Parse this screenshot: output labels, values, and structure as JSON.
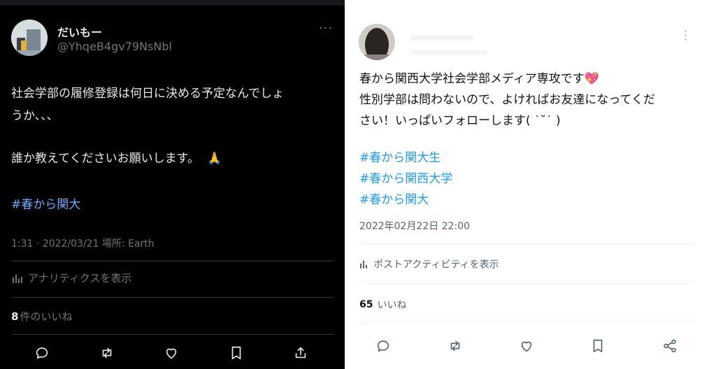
{
  "colors": {
    "left_bg": "#000000",
    "left_text": "#e7e9ea",
    "left_muted": "#71767b",
    "right_bg": "#ffffff",
    "right_text": "#0f1419",
    "right_muted": "#536471",
    "hashtag_left": "#6ea8ff",
    "hashtag_right": "#1d9bf0"
  },
  "left": {
    "user": {
      "name": "だいもー",
      "handle": "@YhqeB4gv79NsNbl"
    },
    "more_icon": "more-horizontal-icon",
    "tweet": {
      "line1": "社会学部の履修登録は何日に決める予定なんでしょ",
      "line2": "うか、、、",
      "line3": "誰か教えてくださいお願いします。",
      "emoji": "🙏",
      "hashtag": "#春から関大"
    },
    "meta": "1:31 · 2022/03/21 場所: Earth",
    "analytics_label": "アナリティクスを表示",
    "likes_count": "8",
    "likes_label": "件のいいね",
    "actions": [
      "reply-icon",
      "retweet-icon",
      "like-icon",
      "bookmark-icon",
      "share-icon"
    ]
  },
  "right": {
    "more_icon": "more-vertical-icon",
    "tweet": {
      "line1": "春から関西大学社会学部メディア専攻です",
      "line1_emoji": "💖",
      "line2": "性別学部は問わないので、よければお友達になってくだ",
      "line3": "さい！いっぱいフォローします(   ˙˘˙ )",
      "hashtags": [
        "#春から関大生",
        "#春から関西大学",
        "#春から関大"
      ]
    },
    "meta": "2022年02月22日 22:00",
    "activity_label": "ポストアクティビティを表示",
    "likes_count": "65",
    "likes_label": "いいね",
    "actions": [
      "reply-icon",
      "retweet-icon",
      "like-icon",
      "bookmark-icon",
      "share-icon"
    ]
  }
}
